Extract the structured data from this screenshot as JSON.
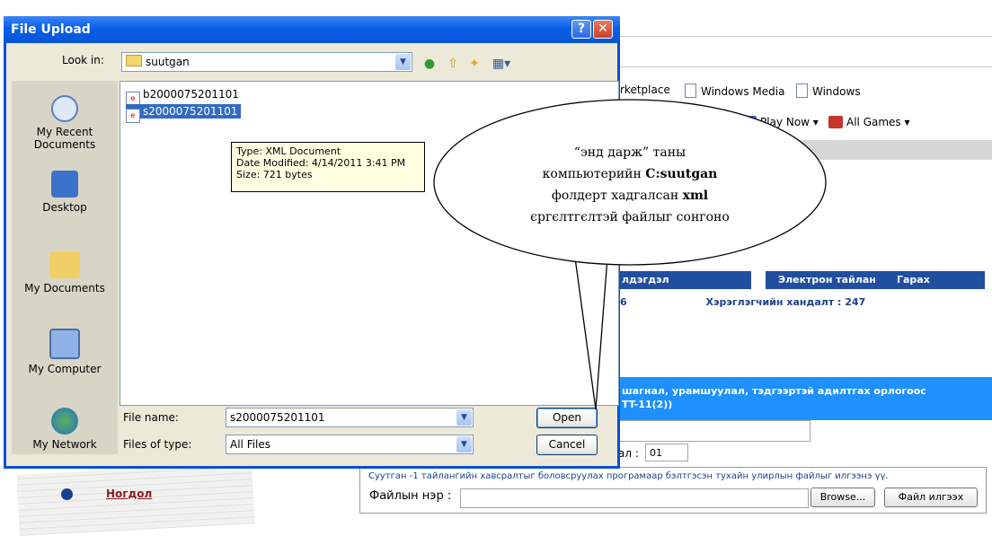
{
  "background": {
    "favorites": [
      {
        "label": "rketplace",
        "icon": "page-icon"
      },
      {
        "label": "Windows Media",
        "icon": "page-icon"
      },
      {
        "label": "Windows",
        "icon": "page-icon"
      }
    ],
    "games": {
      "play_now": "Play Now ▾",
      "all_games": "All Games ▾"
    },
    "menu": [
      {
        "label": "лдэгдэл"
      },
      {
        "label": "Электрон тайлан"
      },
      {
        "label": "Гарах"
      }
    ],
    "info_row": {
      "left": "6",
      "right": "Хэрэглэгчийн хандалт : 247"
    },
    "income_text": {
      "line1": "шагнал, урамшуулал, тэдгээртэй адилтгах орлогоос",
      "line2": "TT-11(2))"
    },
    "field_label": "ал :",
    "field_value": "01",
    "upload": {
      "instruction": "Суутган -1 тайлангийн хавсралтыг боловсруулах програмаар бэлтгэсэн тухайн улирлын файлыг илгээнэ үү.",
      "file_label": "Файлын нэр :",
      "browse": "Browse...",
      "send": "Файл илгээх"
    },
    "nav_link": "Ногдол"
  },
  "dialog": {
    "title": "File Upload",
    "help": "?",
    "close": "✕",
    "look_in_label": "Look in:",
    "look_in_value": "suutgan",
    "places": [
      {
        "label": "My Recent Documents",
        "icon": "recent-documents-icon"
      },
      {
        "label": "Desktop",
        "icon": "desktop-icon"
      },
      {
        "label": "My Documents",
        "icon": "my-documents-icon"
      },
      {
        "label": "My Computer",
        "icon": "my-computer-icon"
      },
      {
        "label": "My Network",
        "icon": "my-network-icon"
      }
    ],
    "files": [
      {
        "name": "b2000075201101",
        "selected": false
      },
      {
        "name": "s2000075201101",
        "selected": true
      }
    ],
    "tooltip": {
      "type": "Type: XML Document",
      "modified": "Date Modified: 4/14/2011 3:41 PM",
      "size": "Size: 721 bytes"
    },
    "file_name_label": "File name:",
    "file_name_value": "s2000075201101",
    "file_type_label": "Files of type:",
    "file_type_value": "All Files",
    "open": "Open",
    "cancel": "Cancel"
  },
  "callout": {
    "line1": "“энд дарж” таны",
    "line2_a": "компьютерийн ",
    "line2_b": "C:suutgan",
    "line3_a": "фолдерт хадгалсан ",
    "line3_b": "xml",
    "line4": "єргєлтгєлтэй  файлыг сонгоно"
  }
}
